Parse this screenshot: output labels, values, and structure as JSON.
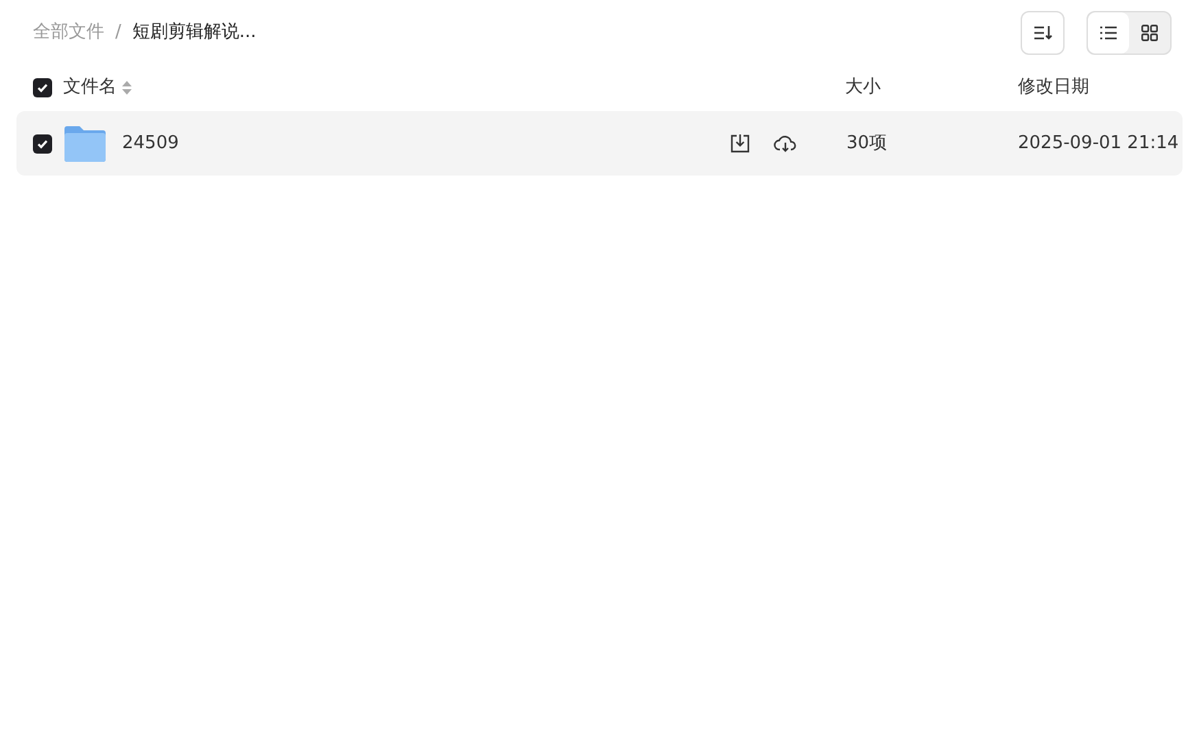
{
  "breadcrumb": [
    {
      "label": "全部文件"
    },
    {
      "label": "短剧剪辑解说..."
    }
  ],
  "breadcrumb_separator": "/",
  "view_modes": [
    {
      "kind": "list",
      "selected": true
    },
    {
      "kind": "grid",
      "selected": false
    }
  ],
  "header": {
    "checked": true,
    "name": "文件名",
    "size": "大小",
    "date": "修改日期"
  },
  "rows": [
    {
      "checked": true,
      "name": "24509",
      "size": "30项",
      "date": "2025-09-01 21:14"
    }
  ]
}
